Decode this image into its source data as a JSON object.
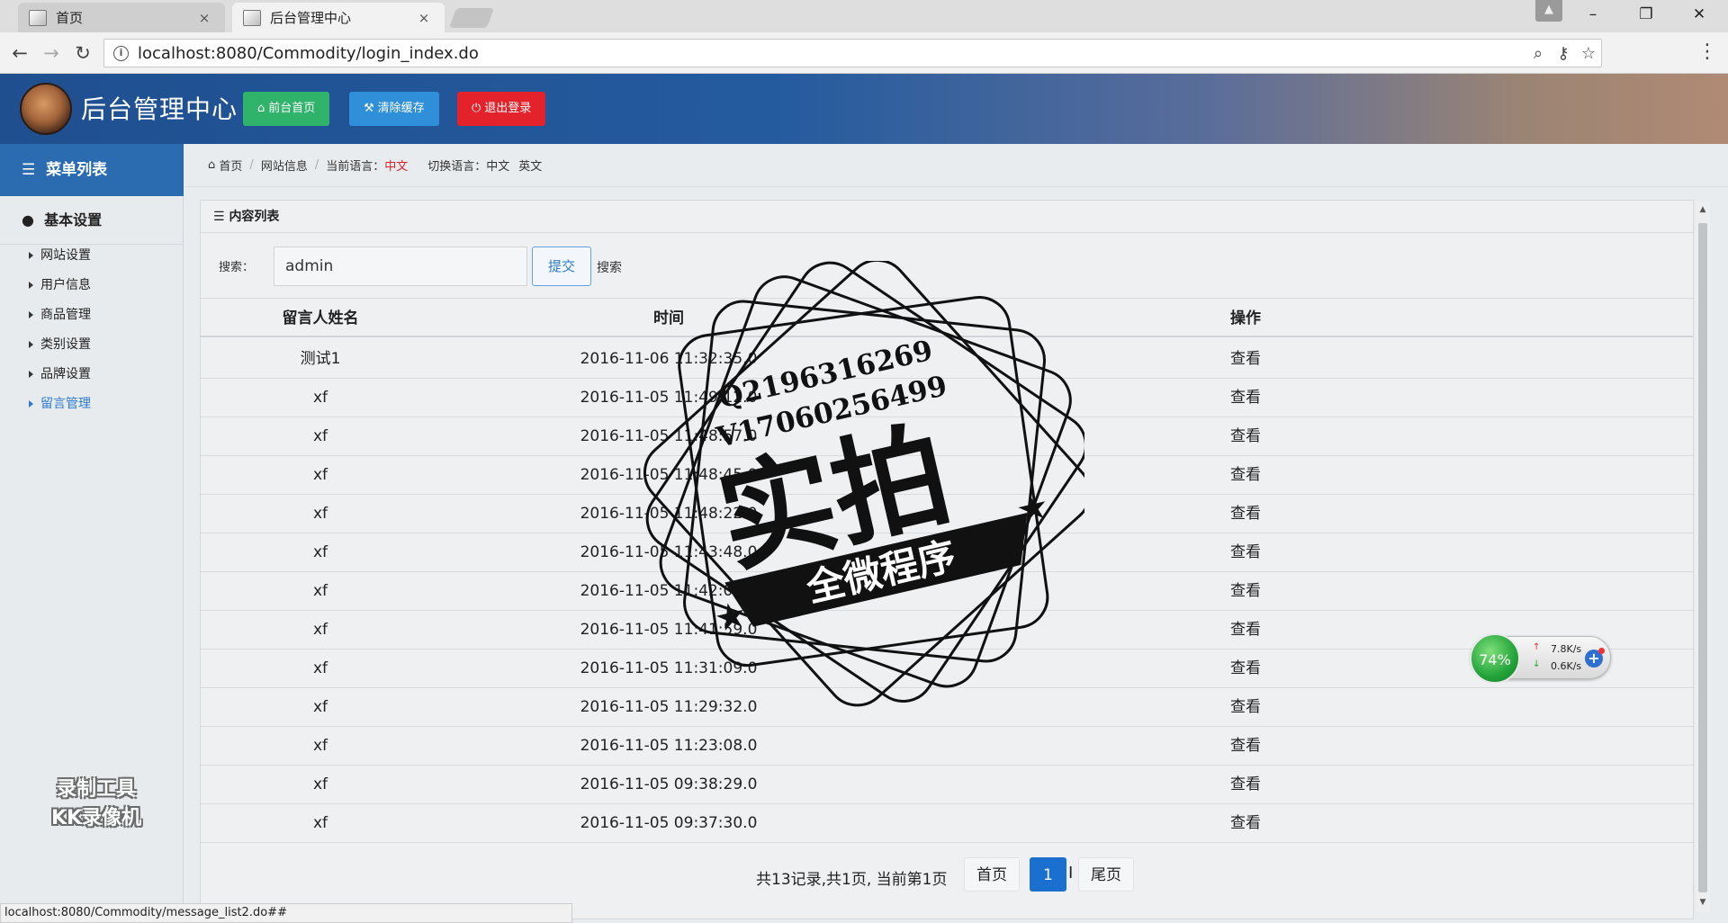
{
  "browser": {
    "tabs": [
      {
        "title": "首页",
        "close": "×"
      },
      {
        "title": "后台管理中心",
        "close": "×"
      }
    ],
    "url": "localhost:8080/Commodity/login_index.do",
    "status_url": "localhost:8080/Commodity/message_list2.do##"
  },
  "header": {
    "title": "后台管理中心",
    "buttons": {
      "home": "前台首页",
      "clear_cache": "清除缓存",
      "logout": "退出登录"
    },
    "colors": {
      "home": "#2fb36a",
      "clear_cache": "#2f8fd8",
      "logout": "#e3222b"
    }
  },
  "sidebar": {
    "menu_title": "菜单列表",
    "group_title": "基本设置",
    "items": [
      {
        "label": "网站设置",
        "active": false
      },
      {
        "label": "用户信息",
        "active": false
      },
      {
        "label": "商品管理",
        "active": false
      },
      {
        "label": "类别设置",
        "active": false
      },
      {
        "label": "品牌设置",
        "active": false
      },
      {
        "label": "留言管理",
        "active": true
      }
    ],
    "watermark_line1": "录制工具",
    "watermark_line2": "KK录像机"
  },
  "breadcrumb": {
    "home": "首页",
    "site_info": "网站信息",
    "current_lang_label": "当前语言：",
    "current_lang": "中文",
    "switch_lang_label": "切换语言：",
    "lang_zh": "中文",
    "lang_en": "英文"
  },
  "panel": {
    "title": "内容列表",
    "search_label": "搜索：",
    "search_value": "admin",
    "submit": "提交",
    "search_tail": "搜索"
  },
  "table": {
    "headers": {
      "name": "留言人姓名",
      "time": "时间",
      "op": "操作"
    },
    "rows": [
      {
        "name": "测试1",
        "time": "2016-11-06 11:32:35.0",
        "op": "查看"
      },
      {
        "name": "xf",
        "time": "2016-11-05 11:49:12.0",
        "op": "查看"
      },
      {
        "name": "xf",
        "time": "2016-11-05 11:48:57.0",
        "op": "查看"
      },
      {
        "name": "xf",
        "time": "2016-11-05 11:48:45.0",
        "op": "查看"
      },
      {
        "name": "xf",
        "time": "2016-11-05 11:48:22.0",
        "op": "查看"
      },
      {
        "name": "xf",
        "time": "2016-11-05 11:43:48.0",
        "op": "查看"
      },
      {
        "name": "xf",
        "time": "2016-11-05 11:42:09.0",
        "op": "查看"
      },
      {
        "name": "xf",
        "time": "2016-11-05 11:41:59.0",
        "op": "查看"
      },
      {
        "name": "xf",
        "time": "2016-11-05 11:31:09.0",
        "op": "查看"
      },
      {
        "name": "xf",
        "time": "2016-11-05 11:29:32.0",
        "op": "查看"
      },
      {
        "name": "xf",
        "time": "2016-11-05 11:23:08.0",
        "op": "查看"
      },
      {
        "name": "xf",
        "time": "2016-11-05 09:38:29.0",
        "op": "查看"
      },
      {
        "name": "xf",
        "time": "2016-11-05 09:37:30.0",
        "op": "查看"
      }
    ]
  },
  "pager": {
    "info": "共13记录,共1页, 当前第1页",
    "first": "首页",
    "current": "1",
    "last": "尾页"
  },
  "netmon": {
    "percent": "74%",
    "up": "7.8K/s",
    "down": "0.6K/s"
  },
  "stamp": {
    "line1": "Q2196316269",
    "line2": "V17060256499",
    "main": "实拍",
    "banner": "全微程序"
  }
}
